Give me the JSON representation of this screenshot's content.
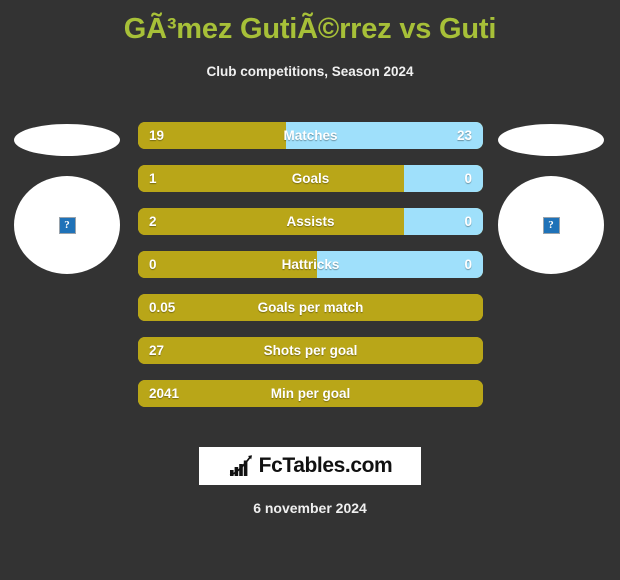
{
  "header": {
    "title": "GÃ³mez GutiÃ©rrez vs Guti",
    "subtitle": "Club competitions, Season 2024",
    "title_color": "#a7c038"
  },
  "colors": {
    "background": "#333333",
    "home_bar": "#b9a618",
    "away_bar": "#9fe0fb",
    "text": "#ffffff"
  },
  "players": [
    {
      "side": "left",
      "photo_status": "broken-image",
      "placeholder_glyph": "?"
    },
    {
      "side": "right",
      "photo_status": "broken-image",
      "placeholder_glyph": "?"
    }
  ],
  "chart_data": {
    "type": "bar",
    "title": "GÃ³mez GutiÃ©rrez vs Guti",
    "subtitle": "Club competitions, Season 2024",
    "orientation": "horizontal-diverging",
    "series": [
      {
        "name": "home",
        "color": "#b9a618"
      },
      {
        "name": "away",
        "color": "#9fe0fb"
      }
    ],
    "categories": [
      "Matches",
      "Goals",
      "Assists",
      "Hattricks",
      "Goals per match",
      "Shots per goal",
      "Min per goal"
    ],
    "rows": [
      {
        "label": "Matches",
        "home": "19",
        "away": "23",
        "home_pct": 43,
        "comparison": true
      },
      {
        "label": "Goals",
        "home": "1",
        "away": "0",
        "home_pct": 77,
        "comparison": true
      },
      {
        "label": "Assists",
        "home": "2",
        "away": "0",
        "home_pct": 77,
        "comparison": true
      },
      {
        "label": "Hattricks",
        "home": "0",
        "away": "0",
        "home_pct": 52,
        "comparison": true
      },
      {
        "label": "Goals per match",
        "home": "0.05",
        "away": "",
        "home_pct": 100,
        "comparison": false
      },
      {
        "label": "Shots per goal",
        "home": "27",
        "away": "",
        "home_pct": 100,
        "comparison": false
      },
      {
        "label": "Min per goal",
        "home": "2041",
        "away": "",
        "home_pct": 100,
        "comparison": false
      }
    ]
  },
  "footer": {
    "logo_text": "FcTables.com",
    "logo_icon": "bar-chart-growth-icon",
    "date": "6 november 2024"
  }
}
